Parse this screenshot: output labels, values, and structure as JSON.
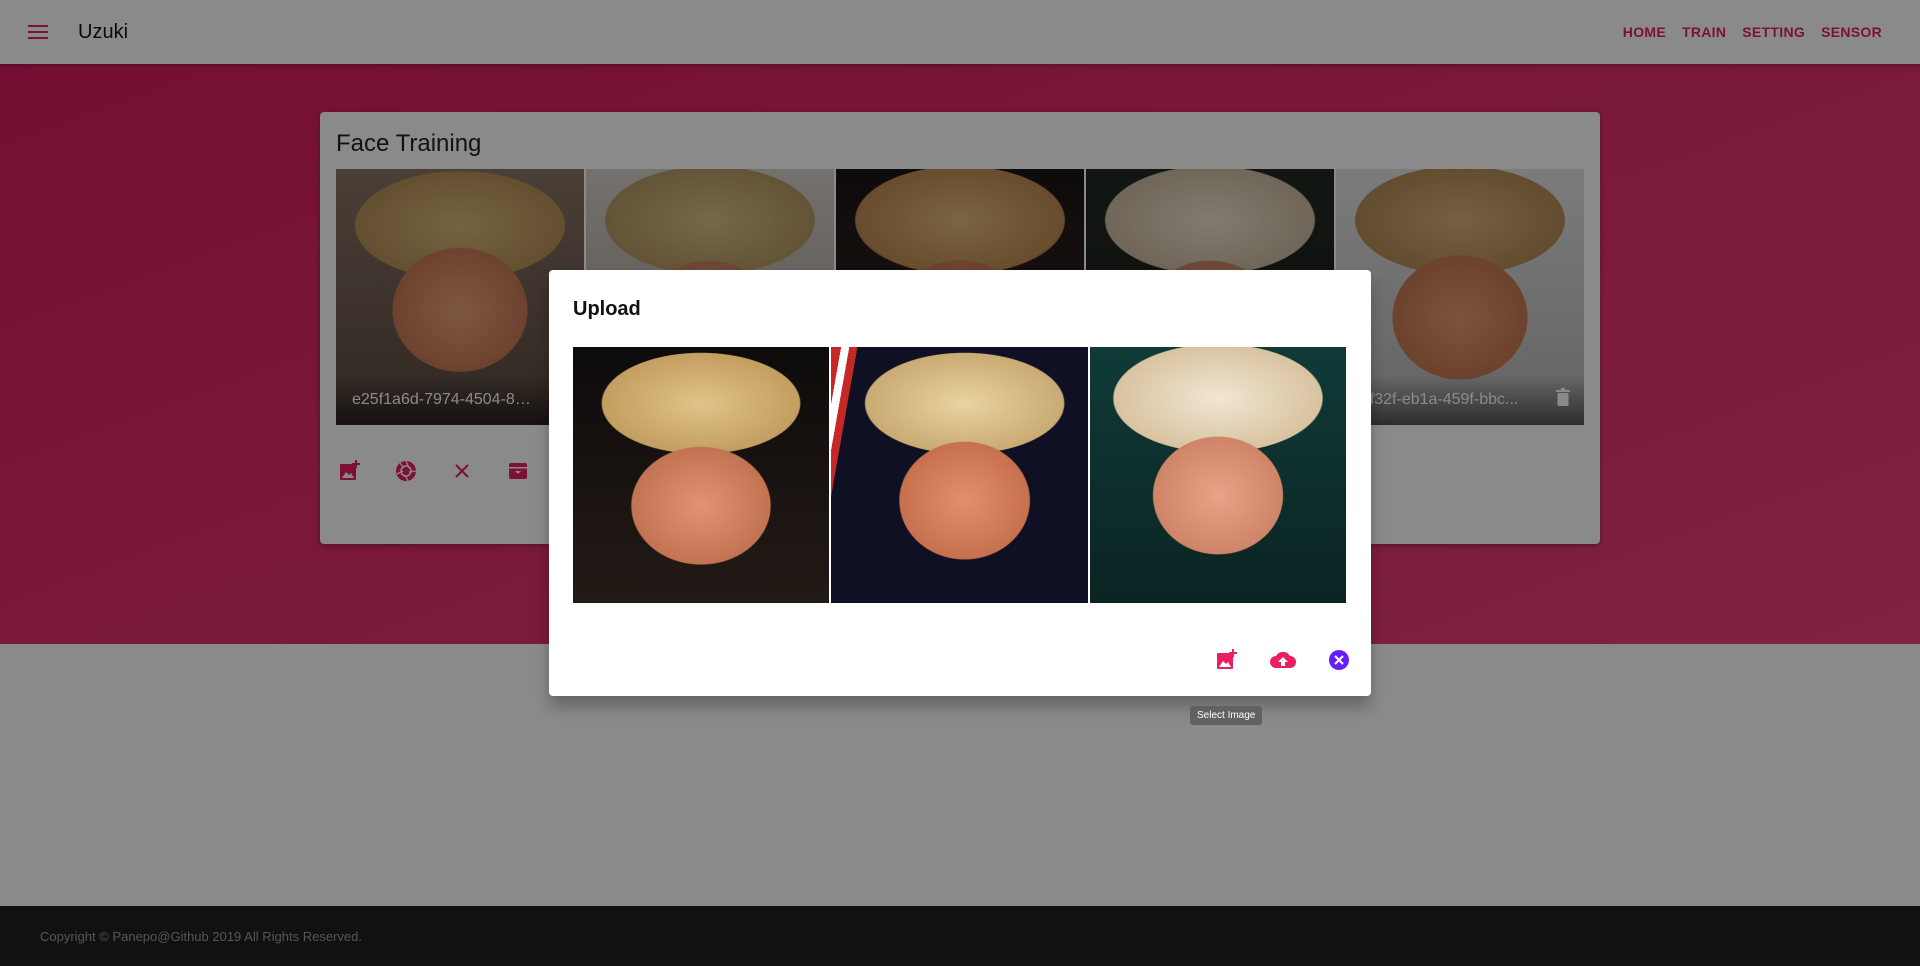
{
  "appbar": {
    "title": "Uzuki",
    "nav": [
      "HOME",
      "TRAIN",
      "SETTING",
      "SENSOR"
    ]
  },
  "card": {
    "title": "Face Training",
    "tiles": [
      {
        "label": "e25f1a6d-7974-4504-85..."
      },
      {
        "label": ""
      },
      {
        "label": ""
      },
      {
        "label": ""
      },
      {
        "label": "dbf32f-eb1a-459f-bbc..."
      }
    ]
  },
  "dialog": {
    "title": "Upload",
    "tooltip": "Select Image"
  },
  "footer": {
    "text": "Copyright © Panepo@Github 2019 All Rights Reserved."
  },
  "colors": {
    "accent": "#e91e63",
    "close_button": "#651fff",
    "footer_bg": "#212121"
  }
}
